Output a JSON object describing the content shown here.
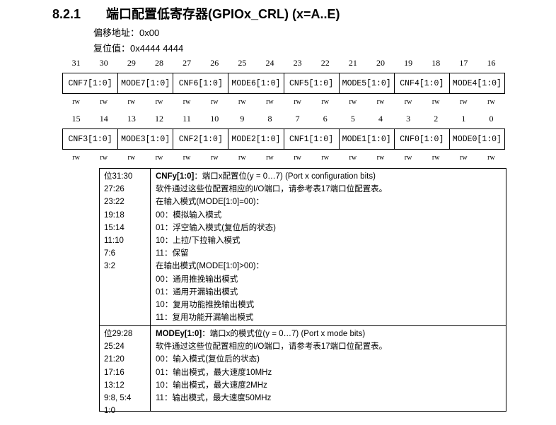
{
  "section": {
    "number": "8.2.1",
    "title": "端口配置低寄存器(GPIOx_CRL) (x=A..E)"
  },
  "register": {
    "offset_label": "偏移地址：",
    "offset_value": "0x00",
    "reset_label": "复位值：",
    "reset_value": "0x4444 4444"
  },
  "upper_bits": [
    "31",
    "30",
    "29",
    "28",
    "27",
    "26",
    "25",
    "24",
    "23",
    "22",
    "21",
    "20",
    "19",
    "18",
    "17",
    "16"
  ],
  "upper_fields": [
    "CNF7[1:0]",
    "MODE7[1:0]",
    "CNF6[1:0]",
    "MODE6[1:0]",
    "CNF5[1:0]",
    "MODE5[1:0]",
    "CNF4[1:0]",
    "MODE4[1:0]"
  ],
  "lower_bits": [
    "15",
    "14",
    "13",
    "12",
    "11",
    "10",
    "9",
    "8",
    "7",
    "6",
    "5",
    "4",
    "3",
    "2",
    "1",
    "0"
  ],
  "lower_fields": [
    "CNF3[1:0]",
    "MODE3[1:0]",
    "CNF2[1:0]",
    "MODE2[1:0]",
    "CNF1[1:0]",
    "MODE1[1:0]",
    "CNF0[1:0]",
    "MODE0[1:0]"
  ],
  "access": [
    "rw",
    "rw",
    "rw",
    "rw",
    "rw",
    "rw",
    "rw",
    "rw",
    "rw",
    "rw",
    "rw",
    "rw",
    "rw",
    "rw",
    "rw",
    "rw"
  ],
  "descriptions": [
    {
      "bits": [
        "位31:30",
        "27:26",
        "23:22",
        "19:18",
        "15:14",
        "11:10",
        "7:6",
        "3:2"
      ],
      "name": "CNFy[1:0]",
      "title": "：端口x配置位(y = 0…7) (Port x configuration bits)",
      "lines": [
        "软件通过这些位配置相应的I/O端口，请参考表17端口位配置表。",
        "在输入模式(MODE[1:0]=00)：",
        "00：模拟输入模式",
        "01：浮空输入模式(复位后的状态)",
        "10：上拉/下拉输入模式",
        "11：保留",
        "在输出模式(MODE[1:0]>00)：",
        "00：通用推挽输出模式",
        "01：通用开漏输出模式",
        "10：复用功能推挽输出模式",
        "11：复用功能开漏输出模式"
      ]
    },
    {
      "bits": [
        "位29:28",
        "25:24",
        "21:20",
        "17:16",
        "13:12",
        "9:8, 5:4",
        "1:0"
      ],
      "name": "MODEy[1:0]",
      "title": "：端口x的模式位(y = 0…7) (Port x mode bits)",
      "lines": [
        "软件通过这些位配置相应的I/O端口，请参考表17端口位配置表。",
        "00：输入模式(复位后的状态)",
        "01：输出模式，最大速度10MHz",
        "10：输出模式，最大速度2MHz",
        "11：输出模式，最大速度50MHz"
      ]
    }
  ]
}
